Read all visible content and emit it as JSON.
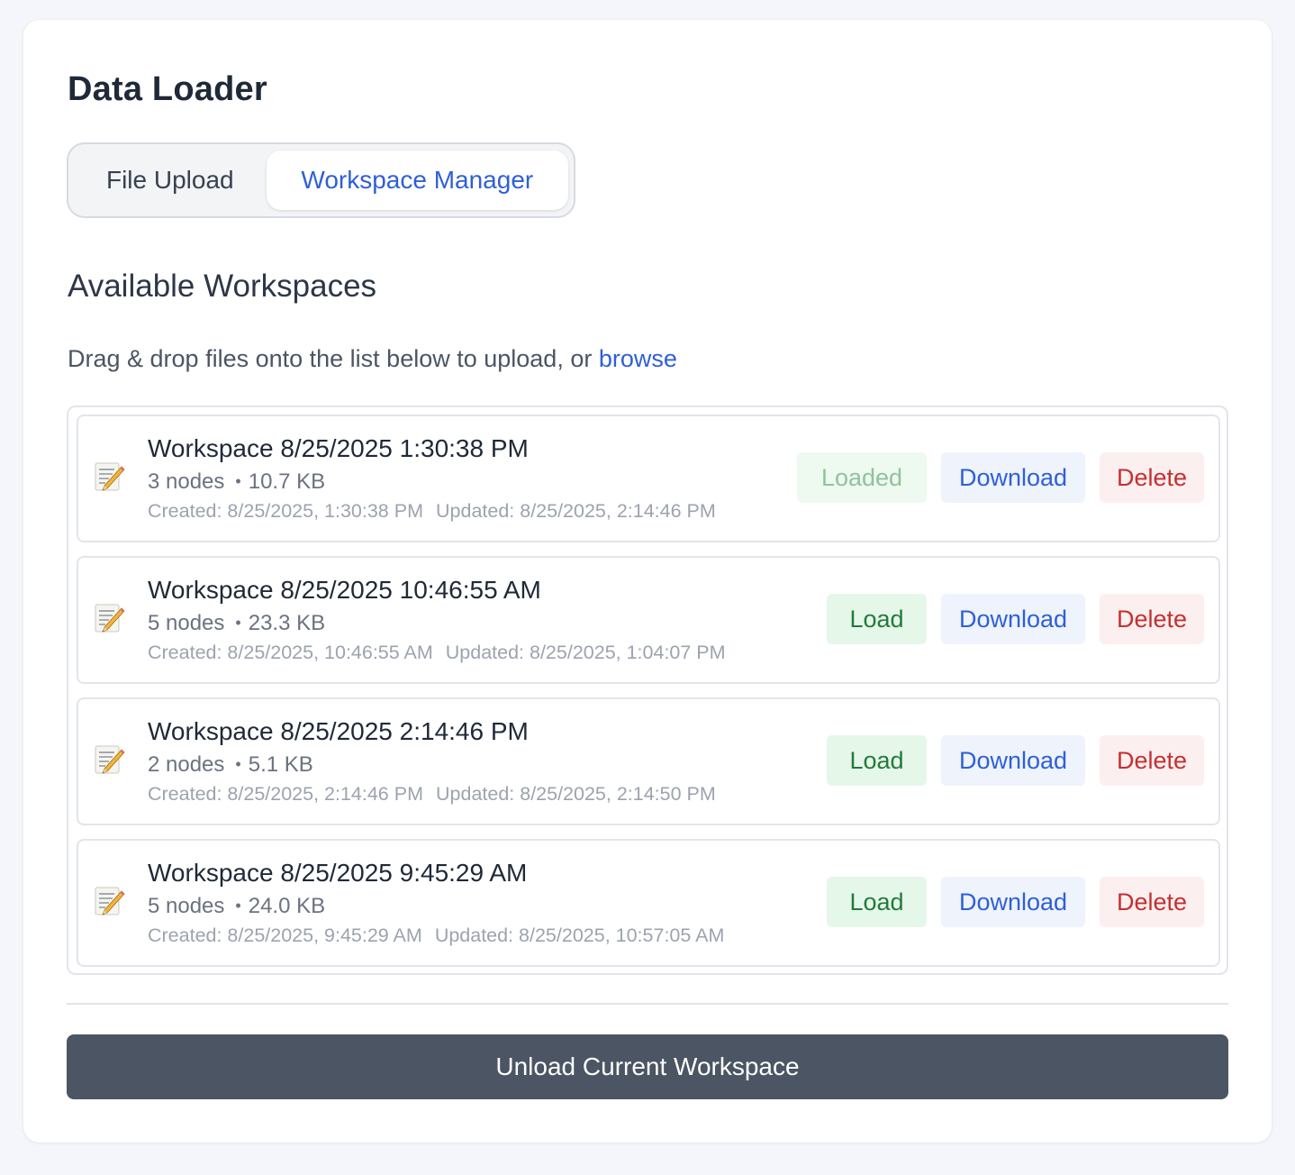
{
  "panel": {
    "title": "Data Loader"
  },
  "tabs": [
    {
      "label": "File Upload",
      "active": false
    },
    {
      "label": "Workspace Manager",
      "active": true
    }
  ],
  "workspaces": {
    "heading": "Available Workspaces",
    "hint_text": "Drag & drop files onto the list below to upload, or ",
    "browse_label": "browse",
    "icon": "memo-pencil-icon",
    "items": [
      {
        "name": "Workspace 8/25/2025 1:30:38 PM",
        "nodes": "3 nodes",
        "size": "10.7 KB",
        "created": "Created: 8/25/2025, 1:30:38 PM",
        "updated": "Updated: 8/25/2025, 2:14:46 PM",
        "load_label": "Loaded",
        "loaded": true,
        "download_label": "Download",
        "delete_label": "Delete"
      },
      {
        "name": "Workspace 8/25/2025 10:46:55 AM",
        "nodes": "5 nodes",
        "size": "23.3 KB",
        "created": "Created: 8/25/2025, 10:46:55 AM",
        "updated": "Updated: 8/25/2025, 1:04:07 PM",
        "load_label": "Load",
        "loaded": false,
        "download_label": "Download",
        "delete_label": "Delete"
      },
      {
        "name": "Workspace 8/25/2025 2:14:46 PM",
        "nodes": "2 nodes",
        "size": "5.1 KB",
        "created": "Created: 8/25/2025, 2:14:46 PM",
        "updated": "Updated: 8/25/2025, 2:14:50 PM",
        "load_label": "Load",
        "loaded": false,
        "download_label": "Download",
        "delete_label": "Delete"
      },
      {
        "name": "Workspace 8/25/2025 9:45:29 AM",
        "nodes": "5 nodes",
        "size": "24.0 KB",
        "created": "Created: 8/25/2025, 9:45:29 AM",
        "updated": "Updated: 8/25/2025, 10:57:05 AM",
        "load_label": "Load",
        "loaded": false,
        "download_label": "Download",
        "delete_label": "Delete"
      }
    ]
  },
  "footer": {
    "unload_label": "Unload Current Workspace"
  },
  "colors": {
    "accent": "#2f5fd8",
    "load_green": "#237a3a",
    "delete_red": "#c53030",
    "unload_bg": "#4b5563"
  }
}
